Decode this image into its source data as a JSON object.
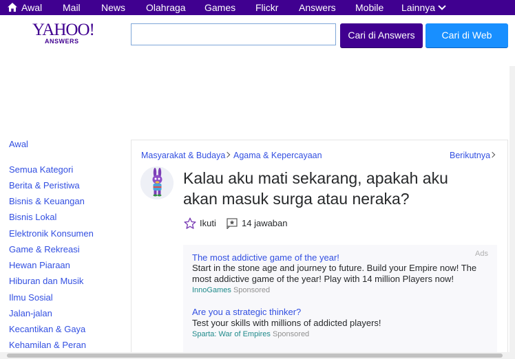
{
  "topnav": {
    "items": [
      {
        "label": "Awal"
      },
      {
        "label": "Mail"
      },
      {
        "label": "News"
      },
      {
        "label": "Olahraga"
      },
      {
        "label": "Games"
      },
      {
        "label": "Flickr"
      },
      {
        "label": "Answers"
      },
      {
        "label": "Mobile"
      },
      {
        "label": "Lainnya"
      }
    ]
  },
  "header": {
    "logo": "YAHOO!",
    "logo_sub": "ANSWERS",
    "search_value": "",
    "search_answers_label": "Cari di Answers",
    "search_web_label": "Cari di Web"
  },
  "sidebar": {
    "home": "Awal",
    "items": [
      {
        "label": "Semua Kategori"
      },
      {
        "label": "Berita & Peristiwa"
      },
      {
        "label": "Bisnis & Keuangan"
      },
      {
        "label": "Bisnis Lokal"
      },
      {
        "label": "Elektronik Konsumen"
      },
      {
        "label": "Game & Rekreasi"
      },
      {
        "label": "Hewan Piaraan"
      },
      {
        "label": "Hiburan dan Musik"
      },
      {
        "label": "Ilmu Sosial"
      },
      {
        "label": "Jalan-jalan"
      },
      {
        "label": "Kecantikan & Gaya"
      },
      {
        "label": "Kehamilan & Peran"
      }
    ]
  },
  "breadcrumb": {
    "level1": "Masyarakat & Budaya",
    "level2": "Agama & Kepercayaan",
    "next": "Berikutnya"
  },
  "question": {
    "title": "Kalau aku mati sekarang, apakah aku akan masuk surga atau neraka?",
    "follow_label": "Ikuti",
    "answers_count": "14 jawaban"
  },
  "ads": {
    "label": "Ads",
    "items": [
      {
        "title": "The most addictive game of the year!",
        "body": "Start in the stone age and journey to future. Build your Empire now! The most addictive game of the year! Play with 14 million Players now!",
        "source": "InnoGames",
        "sponsored": "Sponsored"
      },
      {
        "title": "Are you a strategic thinker?",
        "body": "Test your skills with millions of addicted players!",
        "source": "Sparta: War of Empires",
        "sponsored": "Sponsored"
      }
    ]
  },
  "colors": {
    "brand_purple": "#400090",
    "web_blue": "#188fff",
    "link_blue": "#324fe1"
  }
}
